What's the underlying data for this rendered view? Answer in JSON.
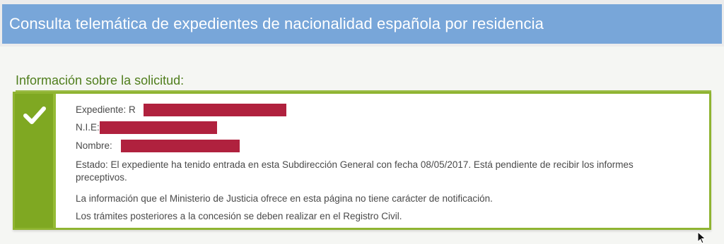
{
  "header": {
    "title": "Consulta telemática de expedientes de nacionalidad española por residencia"
  },
  "section": {
    "heading": "Información sobre la solicitud:"
  },
  "info": {
    "expediente_label": "Expediente: R",
    "nie_label": "N.I.E:",
    "nombre_label": "Nombre:",
    "estado_text": "Estado: El expediente ha tenido entrada en esta Subdirección General con fecha 08/05/2017. Está pendiente de recibir los informes preceptivos.",
    "aviso_text": "La información que el Ministerio de Justicia ofrece en esta página no tiene carácter de notificación.",
    "tramites_text": "Los trámites posteriores a la concesión se deben realizar en el Registro Civil."
  },
  "icons": {
    "status": "checkmark-icon",
    "cursor": "mouse-pointer-icon"
  },
  "colors": {
    "header_bg": "#78a6d9",
    "accent_green": "#7fa822",
    "heading_green": "#4f7d1c",
    "redaction": "#b0213e"
  }
}
